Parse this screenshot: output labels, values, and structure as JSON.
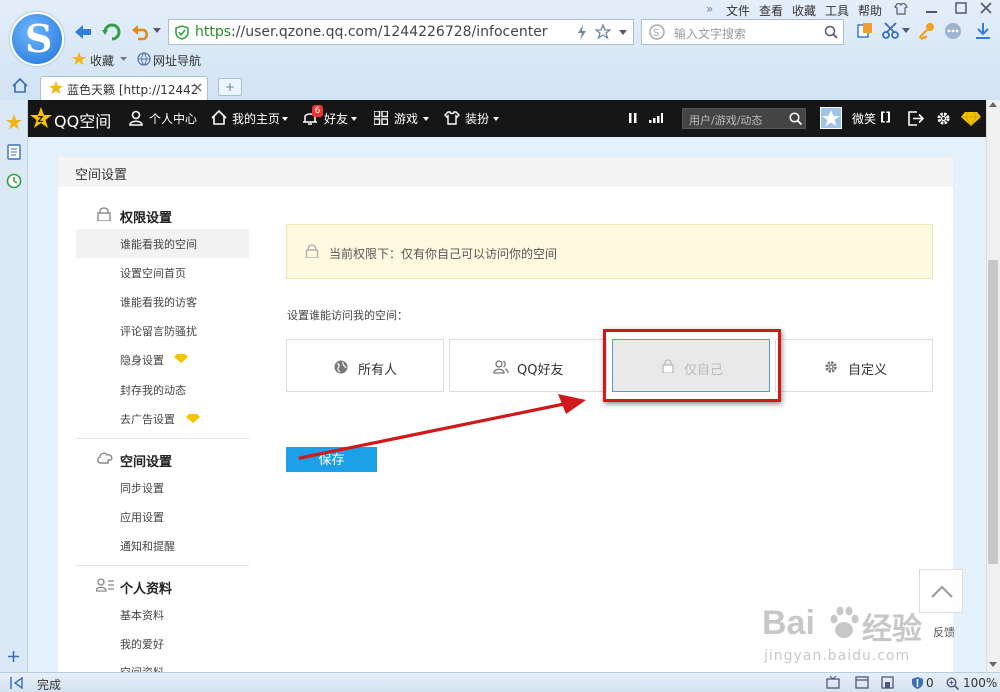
{
  "browser": {
    "menu": [
      "文件",
      "查看",
      "收藏",
      "工具",
      "帮助"
    ],
    "url_scheme": "https",
    "url_rest": "://user.qzone.qq.com/1244226728/infocenter",
    "search_placeholder": "输入文字搜索",
    "bookmarks": [
      "收藏",
      "网址导航"
    ],
    "tab_title": "蓝色天籁 [http://12442",
    "status": "完成",
    "status_count": "0",
    "zoom": "100%",
    "menu_arrows": "»"
  },
  "qzone_nav": {
    "logo": "QQ空间",
    "items": [
      "个人中心",
      "我的主页",
      "好友",
      "游戏",
      "装扮"
    ],
    "friend_badge": "6",
    "search_placeholder": "用户/游戏/动态",
    "user": "微笑",
    "user_suffix": "[]"
  },
  "panel": {
    "title": "空间设置",
    "sections": [
      {
        "title": "权限设置",
        "icon": "lock-icon",
        "items": [
          {
            "label": "谁能看我的空间",
            "active": true
          },
          {
            "label": "设置空间首页"
          },
          {
            "label": "谁能看我的访客"
          },
          {
            "label": "评论留言防骚扰"
          },
          {
            "label": "隐身设置",
            "vip": true
          },
          {
            "label": "封存我的动态"
          },
          {
            "label": "去广告设置",
            "vip": true
          }
        ]
      },
      {
        "title": "空间设置",
        "icon": "cloud-icon",
        "items": [
          {
            "label": "同步设置"
          },
          {
            "label": "应用设置"
          },
          {
            "label": "通知和提醒"
          }
        ]
      },
      {
        "title": "个人资料",
        "icon": "profile-icon",
        "items": [
          {
            "label": "基本资料"
          },
          {
            "label": "我的爱好"
          },
          {
            "label": "空间资料"
          }
        ]
      }
    ],
    "notice": "当前权限下：仅有你自己可以访问你的空间",
    "set_label": "设置谁能访问我的空间：",
    "options": [
      {
        "label": "所有人",
        "icon": "globe-icon"
      },
      {
        "label": "QQ好友",
        "icon": "friends-icon"
      },
      {
        "label": "仅自己",
        "icon": "lock-icon",
        "selected": true
      },
      {
        "label": "自定义",
        "icon": "gear-icon"
      }
    ],
    "save": "保存",
    "feedback": "反馈"
  },
  "watermark": {
    "brand": "Bai",
    "brand2": "经验",
    "url": "jingyan.baidu.com"
  },
  "colors": {
    "accent": "#1ea0e8",
    "highlight": "#d0191b",
    "navbar": "#161616",
    "vip": "#f5c400",
    "notice_bg": "#fff9e0"
  }
}
